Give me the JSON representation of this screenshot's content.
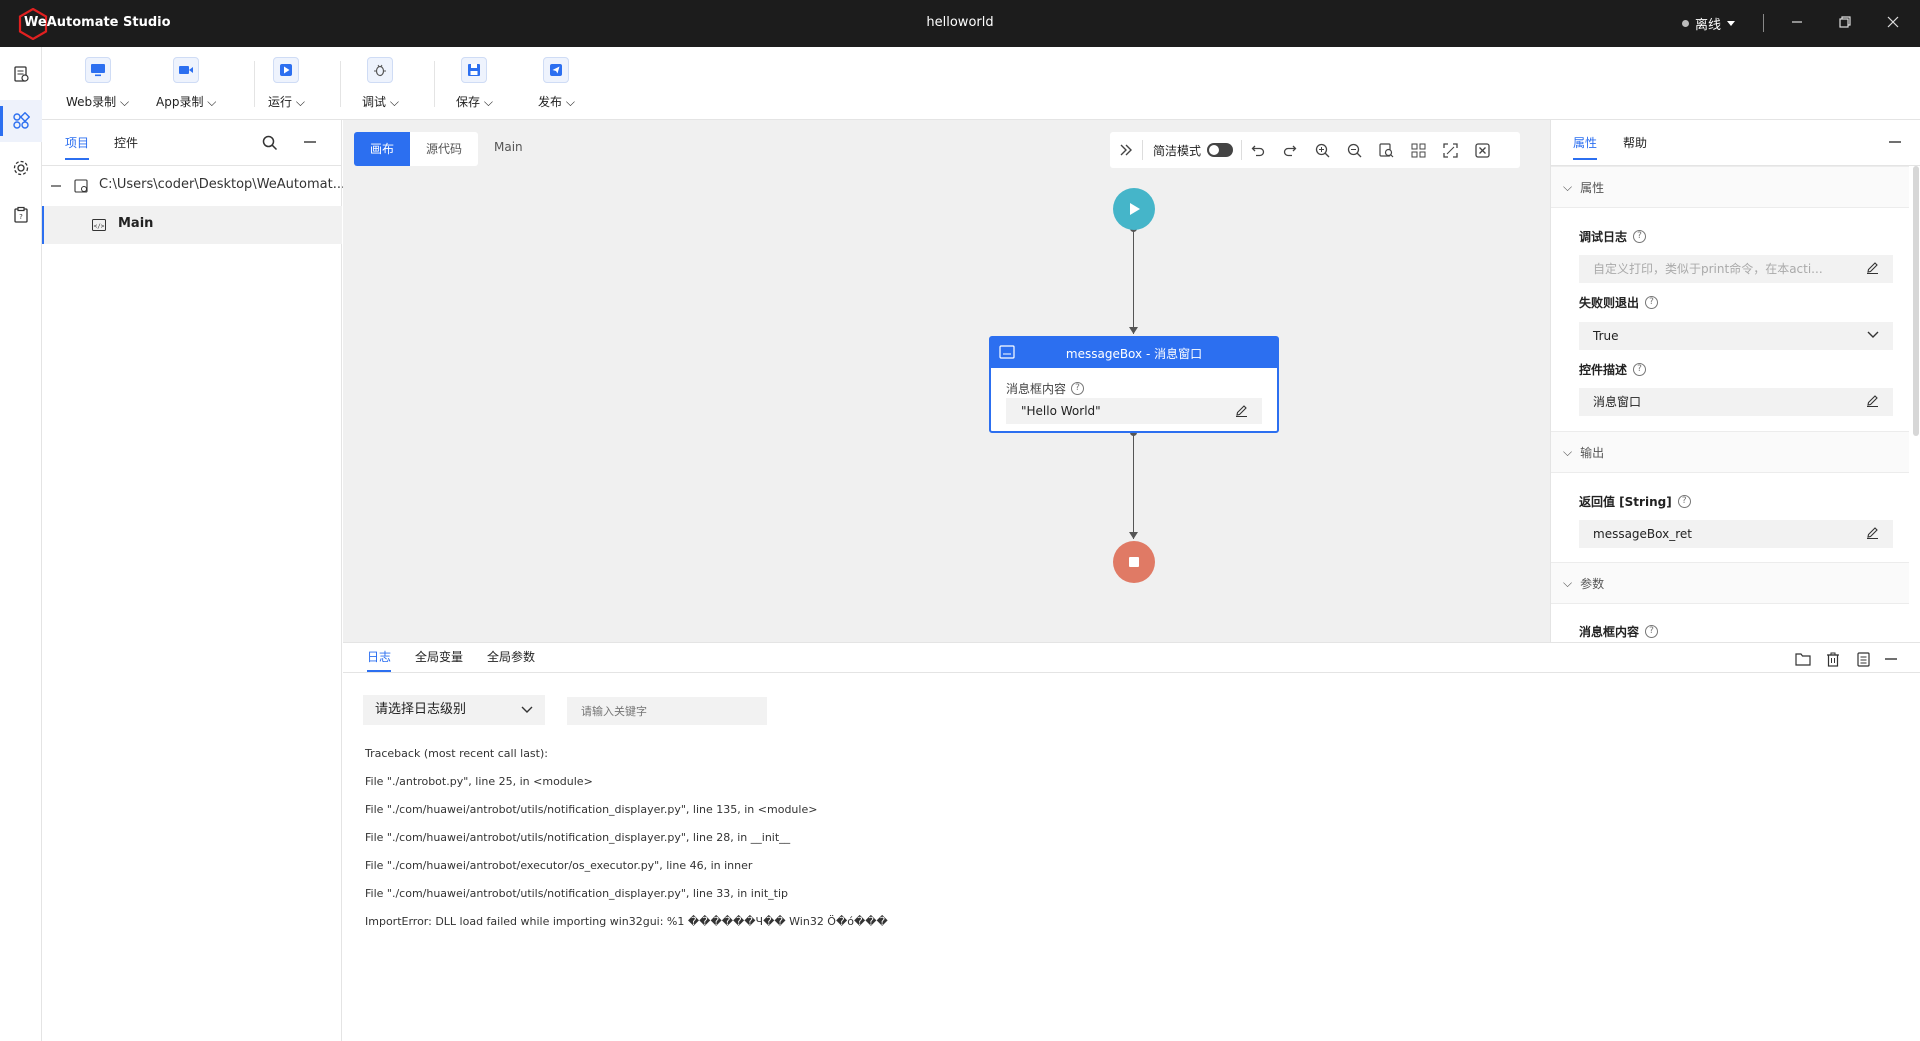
{
  "app": {
    "name": "WeAutomate Studio",
    "document_title": "helloworld",
    "status": "离线"
  },
  "toolbar": {
    "web_record": "Web录制",
    "app_record": "App录制",
    "run": "运行",
    "debug": "调试",
    "save": "保存",
    "publish": "发布"
  },
  "project_panel": {
    "tabs": [
      "项目",
      "控件"
    ],
    "root_path": "C:\\Users\\coder\\Desktop\\WeAutomat...",
    "main_item": "Main"
  },
  "canvas": {
    "tabs": [
      "画布",
      "源代码"
    ],
    "breadcrumb": "Main",
    "simple_mode_label": "简洁模式",
    "node": {
      "title": "messageBox - 消息窗口",
      "param_label": "消息框内容",
      "param_value": "\"Hello World\""
    }
  },
  "properties": {
    "tabs": [
      "属性",
      "帮助"
    ],
    "section_props": "属性",
    "debug_log_label": "调试日志",
    "debug_log_placeholder": "自定义打印，类似于print命令，在本acti...",
    "fail_exit_label": "失败则退出",
    "fail_exit_value": "True",
    "ctrl_desc_label": "控件描述",
    "ctrl_desc_value": "消息窗口",
    "section_output": "输出",
    "return_label": "返回值 [String]",
    "return_value": "messageBox_ret",
    "section_params": "参数",
    "msg_content_label": "消息框内容"
  },
  "log_panel": {
    "tabs": [
      "日志",
      "全局变量",
      "全局参数"
    ],
    "level_placeholder": "请选择日志级别",
    "search_placeholder": "请输入关键字",
    "lines": [
      "Traceback (most recent call last):",
      "File \"./antrobot.py\", line 25, in <module>",
      "File \"./com/huawei/antrobot/utils/notification_displayer.py\", line 135, in <module>",
      "File \"./com/huawei/antrobot/utils/notification_displayer.py\", line 28, in __init__",
      "File \"./com/huawei/antrobot/executor/os_executor.py\", line 46, in inner",
      "File \"./com/huawei/antrobot/utils/notification_displayer.py\", line 33, in init_tip",
      "ImportError: DLL load failed while importing win32gui: %1 ������Ч�� Win32 Ӧ�ó���"
    ]
  },
  "colors": {
    "accent": "#2c6ff0",
    "start_node": "#45b5c9",
    "end_node": "#e07a65",
    "titlebar": "#1c1c1c"
  }
}
